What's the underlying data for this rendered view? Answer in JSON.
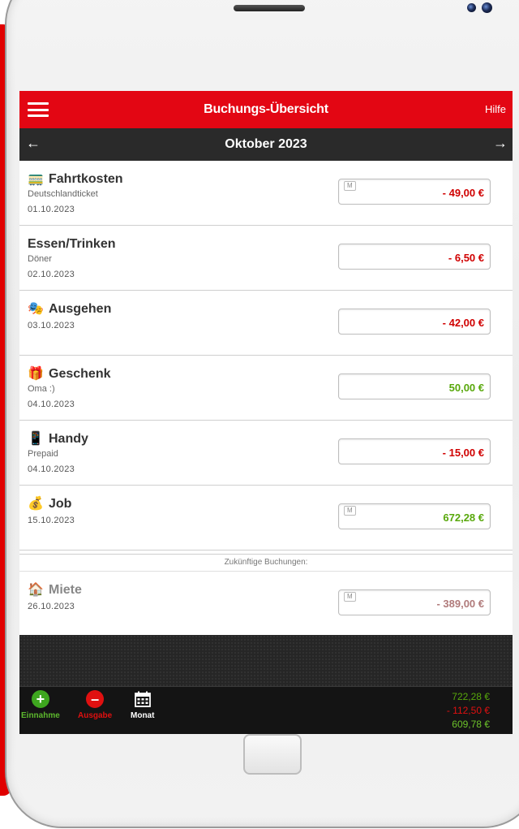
{
  "header": {
    "title": "Buchungs-Übersicht",
    "help": "Hilfe"
  },
  "month_nav": {
    "label": "Oktober 2023",
    "prev_icon": "arrow-left-icon",
    "next_icon": "arrow-right-icon"
  },
  "entries": [
    {
      "name": "Fahrtkosten",
      "icon": "train-icon",
      "icon_glyph": "🚃",
      "sub": "Deutschlandticket",
      "date": "01.10.2023",
      "amount": "- 49,00  €",
      "type": "neg",
      "tag": "M"
    },
    {
      "name": "Essen/Trinken",
      "icon": "",
      "icon_glyph": "",
      "sub": "Döner",
      "date": "02.10.2023",
      "amount": "- 6,50  €",
      "type": "neg",
      "tag": ""
    },
    {
      "name": "Ausgehen",
      "icon": "theater-masks-icon",
      "icon_glyph": "🎭",
      "sub": "",
      "date": "03.10.2023",
      "amount": "- 42,00  €",
      "type": "neg",
      "tag": ""
    },
    {
      "name": "Geschenk",
      "icon": "gift-icon",
      "icon_glyph": "🎁",
      "sub": "Oma :)",
      "date": "04.10.2023",
      "amount": "50,00  €",
      "type": "pos",
      "tag": ""
    },
    {
      "name": "Handy",
      "icon": "mobile-phone-icon",
      "icon_glyph": "📱",
      "sub": "Prepaid",
      "date": "04.10.2023",
      "amount": "- 15,00  €",
      "type": "neg",
      "tag": ""
    },
    {
      "name": "Job",
      "icon": "money-bag-icon",
      "icon_glyph": "💰",
      "sub": "",
      "date": "15.10.2023",
      "amount": "672,28  €",
      "type": "pos",
      "tag": "M"
    }
  ],
  "future": {
    "label": "Zukünftige Buchungen:",
    "entries": [
      {
        "name": "Miete",
        "icon": "house-icon",
        "icon_glyph": "🏠",
        "sub": "",
        "date": "26.10.2023",
        "amount": "- 389,00  €",
        "type": "future-neg",
        "tag": "M"
      }
    ]
  },
  "footer": {
    "income_label": "Einnahme",
    "expense_label": "Ausgabe",
    "month_label": "Monat",
    "total_income": "722,28  €",
    "total_expense": "- 112,50  €",
    "balance": "609,78  €"
  },
  "colors": {
    "brand_red": "#e30613",
    "positive": "#58a80b",
    "negative": "#d00000"
  }
}
